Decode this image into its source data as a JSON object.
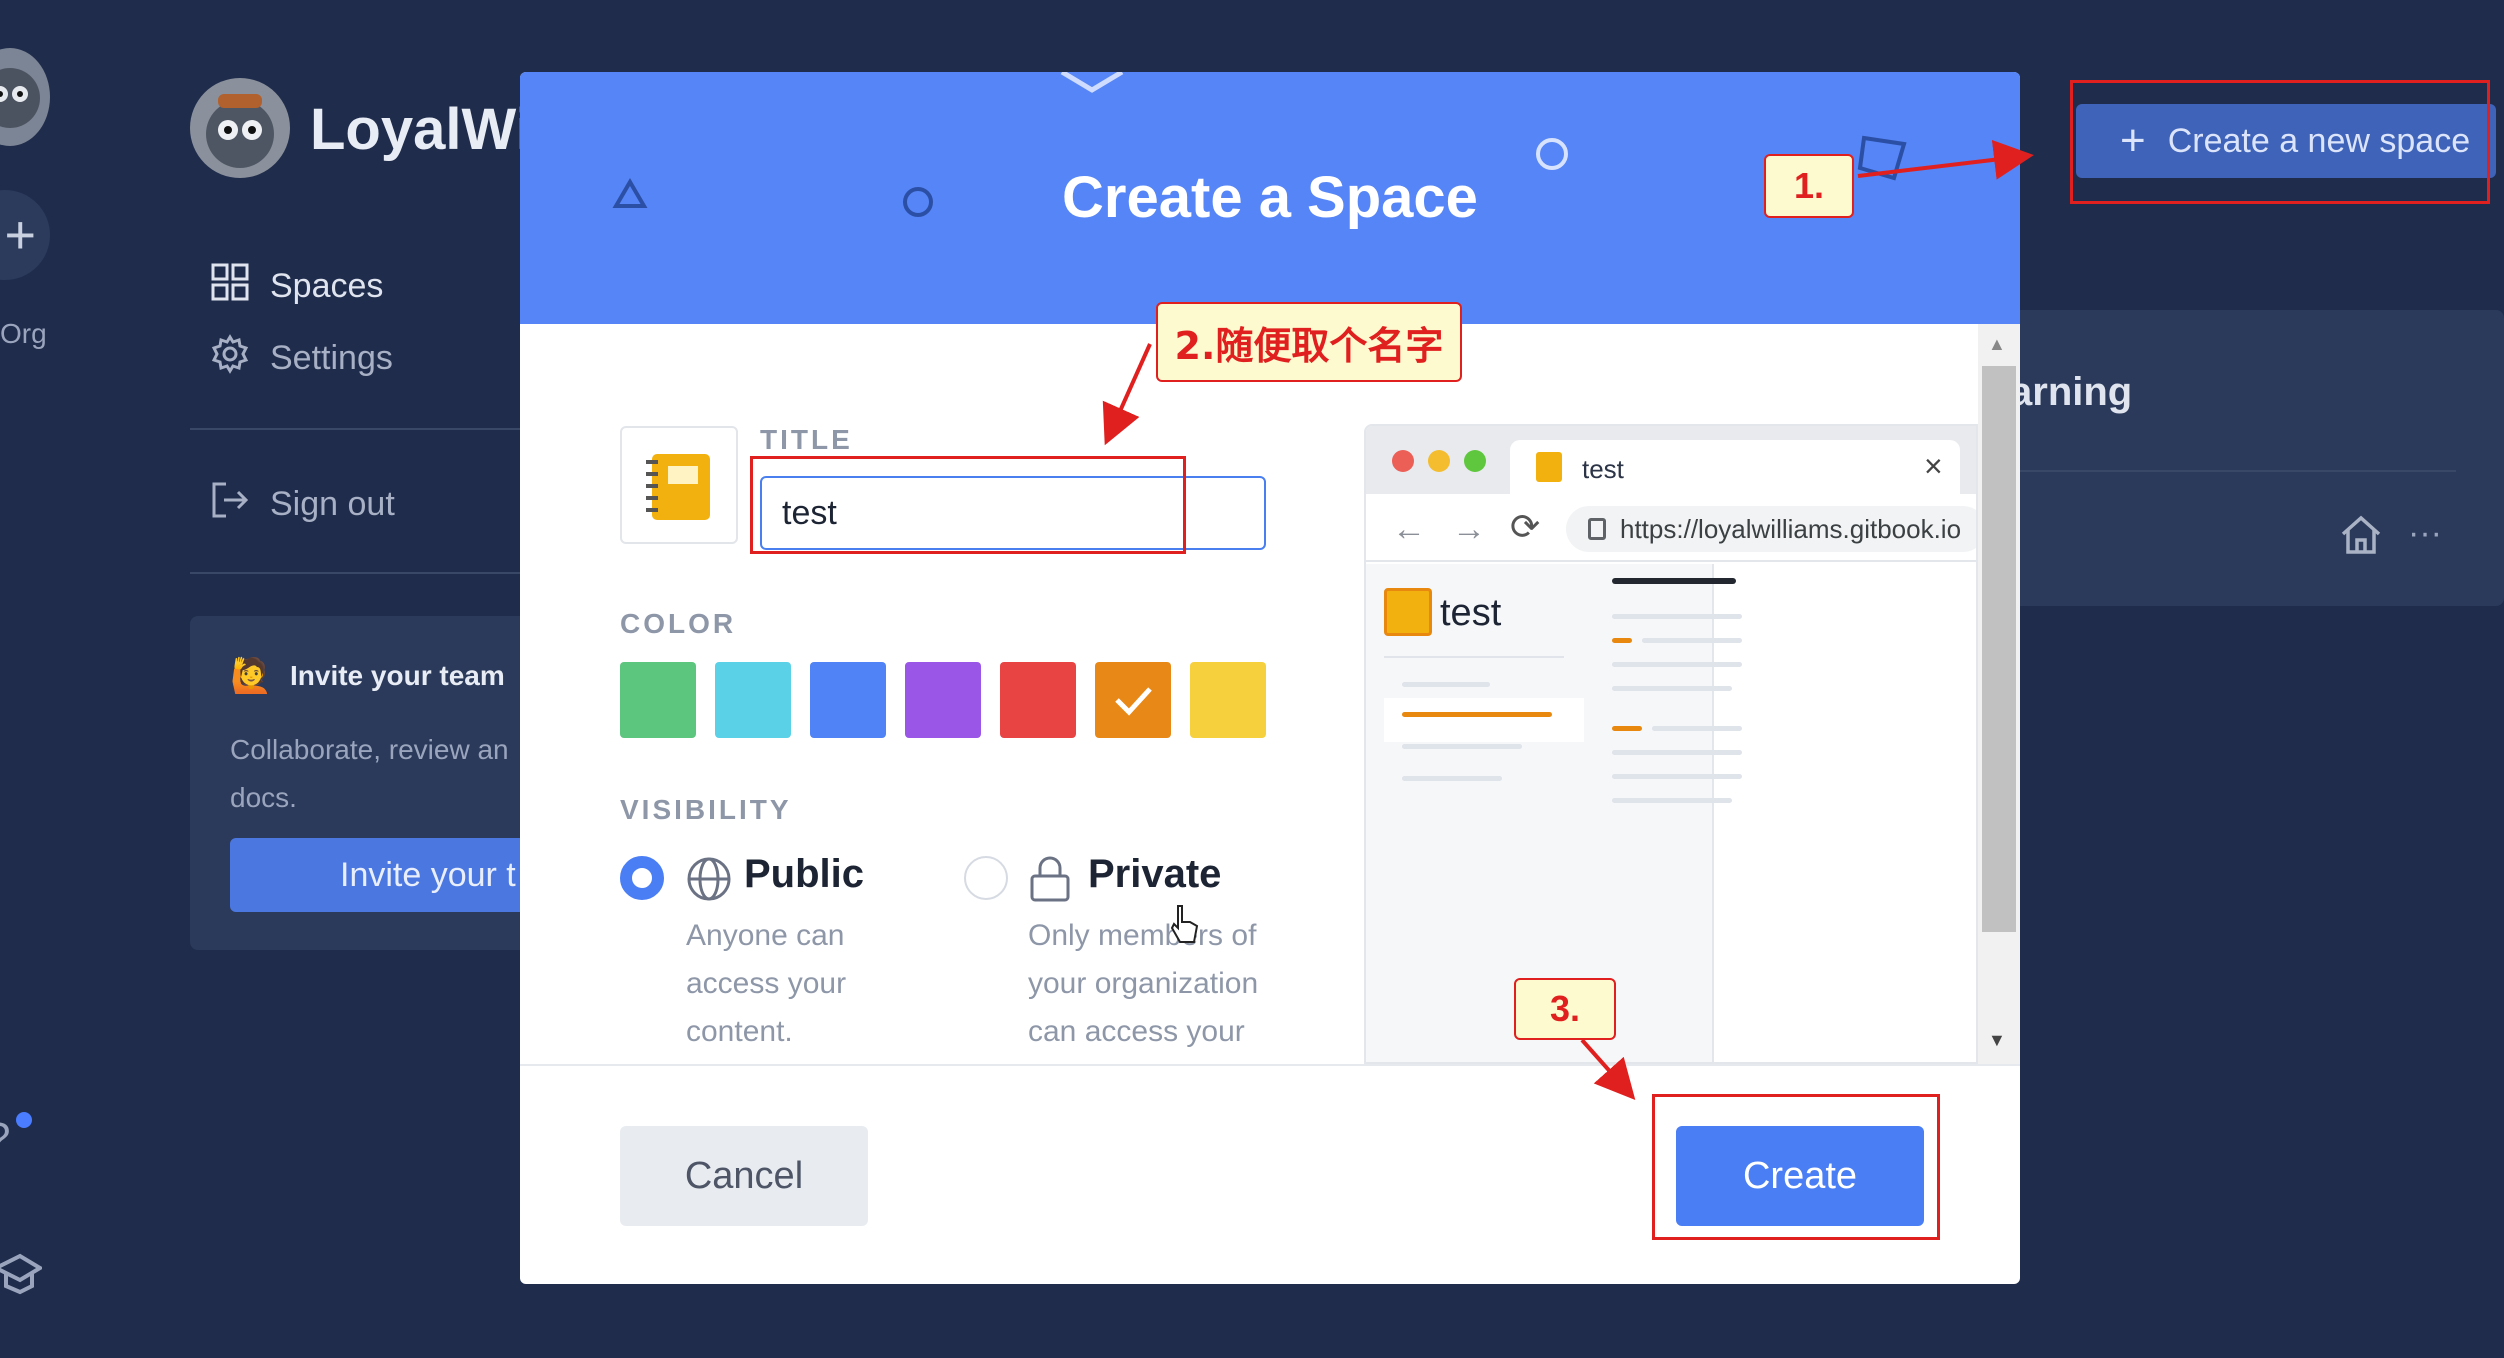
{
  "rail": {
    "org_label": "Org",
    "plus": "+"
  },
  "sidebar": {
    "org_name": "LoyalWi",
    "nav": [
      {
        "label": "Spaces",
        "icon": "grid-icon"
      },
      {
        "label": "Settings",
        "icon": "gear-icon"
      },
      {
        "label": "Sign out",
        "icon": "sign-out-icon"
      }
    ],
    "invite": {
      "title": "Invite your team",
      "description": "Collaborate, review an docs.",
      "button": "Invite your t"
    }
  },
  "page": {
    "new_space_button": "Create a new space",
    "card_title": "arning"
  },
  "modal": {
    "title": "Create a Space",
    "title_label": "TITLE",
    "title_value": "test",
    "color_label": "COLOR",
    "colors": [
      "#5cc57e",
      "#5bd1e8",
      "#4f83f6",
      "#9a56e6",
      "#e84444",
      "#e88816",
      "#f6d03d"
    ],
    "selected_color_index": 5,
    "visibility_label": "VISIBILITY",
    "visibility": {
      "public_title": "Public",
      "public_desc": "Anyone can access your content.",
      "private_title": "Private",
      "private_desc": "Only members of your organization can access your",
      "selected": "public"
    },
    "preview": {
      "tab_title": "test",
      "url": "https://loyalwilliams.gitbook.io",
      "space_name": "test"
    },
    "cancel": "Cancel",
    "create": "Create"
  },
  "annotations": {
    "step1": "1.",
    "step2": "2.随便取个名字",
    "step3": "3."
  },
  "colors": {
    "background": "#1f2c4c",
    "header": "#5585f6",
    "accent": "#4a7ef5",
    "annotation": "#e0201f"
  }
}
